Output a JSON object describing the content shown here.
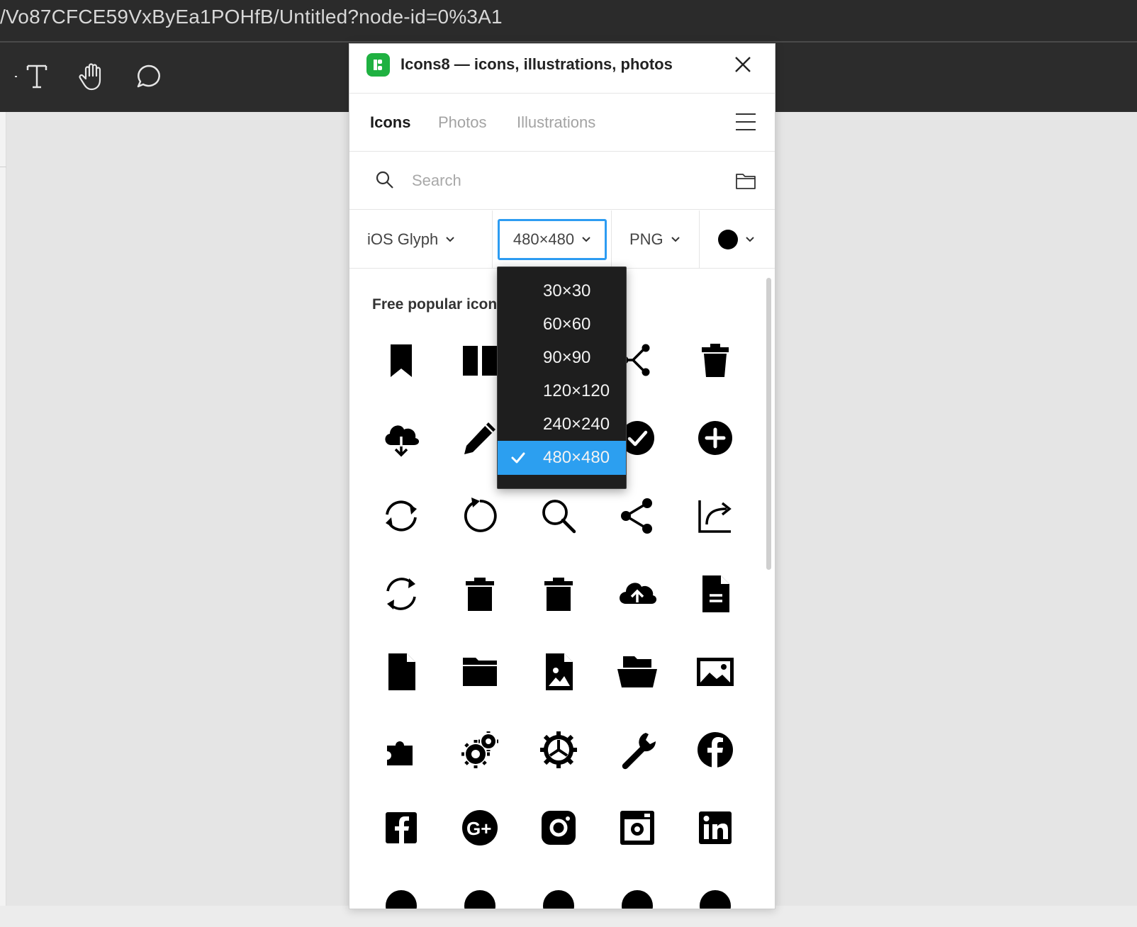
{
  "browser": {
    "url": "/Vo87CFCE59VxByEa1POHfB/Untitled?node-id=0%3A1"
  },
  "toolbar": {
    "tools": [
      {
        "name": "text-tool-icon"
      },
      {
        "name": "hand-tool-icon"
      },
      {
        "name": "comment-tool-icon"
      }
    ]
  },
  "plugin": {
    "title": "Icons8 — icons, illustrations, photos",
    "tabs": [
      {
        "label": "Icons",
        "active": true
      },
      {
        "label": "Photos",
        "active": false
      },
      {
        "label": "Illustrations",
        "active": false
      }
    ],
    "search": {
      "placeholder": "Search",
      "value": ""
    },
    "filters": {
      "style": "iOS Glyph",
      "size": "480×480",
      "format": "PNG",
      "color": "#000000"
    },
    "section_title": "Free popular icons",
    "icons": [
      [
        "bookmark-icon",
        "book-icon",
        "hidden-icon",
        "connection-icon",
        "trash-icon"
      ],
      [
        "cloud-download-icon",
        "pencil-icon",
        "hidden-icon",
        "checkmark-icon",
        "plus-icon"
      ],
      [
        "sync-icon",
        "restart-icon",
        "search-icon",
        "share-icon",
        "share-chart-icon"
      ],
      [
        "refresh-icon",
        "delete-icon",
        "trash-can-icon",
        "cloud-upload-icon",
        "document-icon"
      ],
      [
        "file-icon",
        "folder-icon",
        "image-file-icon",
        "open-folder-icon",
        "picture-icon"
      ],
      [
        "puzzle-icon",
        "gears-icon",
        "settings-icon",
        "wrench-icon",
        "facebook-circle-icon"
      ],
      [
        "facebook-square-icon",
        "google-plus-icon",
        "instagram-icon",
        "instagram-old-icon",
        "linkedin-icon"
      ]
    ]
  },
  "size_dropdown": {
    "options": [
      "30×30",
      "60×60",
      "90×90",
      "120×120",
      "240×240",
      "480×480"
    ],
    "selected": "480×480"
  },
  "colors": {
    "accent": "#2d9cf2",
    "brand": "#1fb141",
    "dropdown_bg": "#1e1e1e"
  }
}
